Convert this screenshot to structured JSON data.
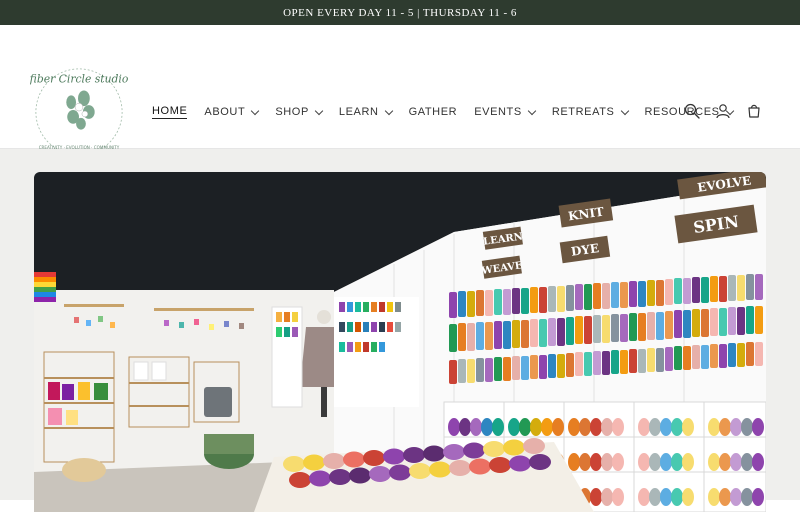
{
  "announcement": {
    "text": "OPEN EVERY DAY 11 - 5 | THURSDAY 11 - 6"
  },
  "logo": {
    "text": "fiber Circle studio",
    "tagline": "CREATIVITY · EVOLUTION · COMMUNITY"
  },
  "nav": {
    "items": [
      {
        "label": "HOME",
        "dropdown": false,
        "active": true
      },
      {
        "label": "ABOUT",
        "dropdown": true
      },
      {
        "label": "SHOP",
        "dropdown": true
      },
      {
        "label": "LEARN",
        "dropdown": true
      },
      {
        "label": "GATHER",
        "dropdown": false
      },
      {
        "label": "EVENTS",
        "dropdown": true
      },
      {
        "label": "RETREATS",
        "dropdown": true
      },
      {
        "label": "RESOURCES",
        "dropdown": true
      }
    ]
  },
  "header_icons": [
    "search-icon",
    "account-icon",
    "cart-icon"
  ],
  "hero": {
    "signs": [
      "LEARN",
      "WEAVE",
      "KNIT",
      "DYE",
      "EVOLVE",
      "SPIN"
    ]
  },
  "colors": {
    "announcement_bg": "#2e3b2f",
    "page_bg": "#efefed"
  }
}
